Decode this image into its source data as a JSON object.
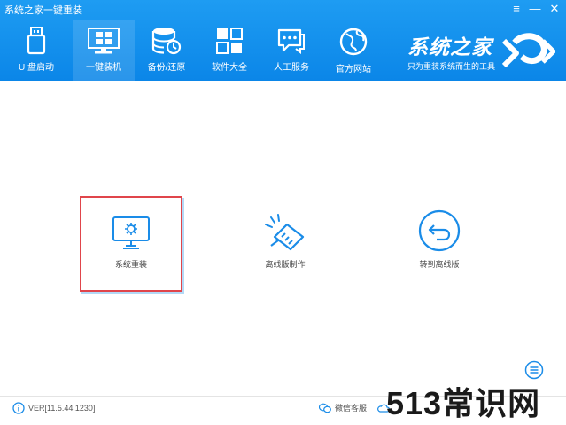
{
  "window": {
    "title": "系统之家一键重装",
    "controls": [
      "≡",
      "—",
      "✕"
    ]
  },
  "nav": [
    {
      "label": "U 盘启动",
      "icon": "usb-icon"
    },
    {
      "label": "一键装机",
      "icon": "windows-monitor-icon",
      "active": true
    },
    {
      "label": "备份/还原",
      "icon": "database-restore-icon"
    },
    {
      "label": "软件大全",
      "icon": "apps-grid-icon"
    },
    {
      "label": "人工服务",
      "icon": "chat-icon"
    },
    {
      "label": "官方网站",
      "icon": "globe-icon"
    }
  ],
  "brand": {
    "name": "系统之家",
    "slogan": "只为重装系统而生的工具"
  },
  "options": [
    {
      "label": "系统重装",
      "icon": "monitor-gear-icon",
      "selected": true
    },
    {
      "label": "离线版制作",
      "icon": "network-plug-icon"
    },
    {
      "label": "转到离线版",
      "icon": "back-circle-icon"
    }
  ],
  "footer": {
    "version": "VER[11.5.44.1230]",
    "wechat": "微信客服"
  },
  "watermark": "513常识网",
  "colors": {
    "header_blue": "#1a95ee",
    "accent_blue": "#1a8ce8",
    "selected_border": "#e0454b"
  }
}
